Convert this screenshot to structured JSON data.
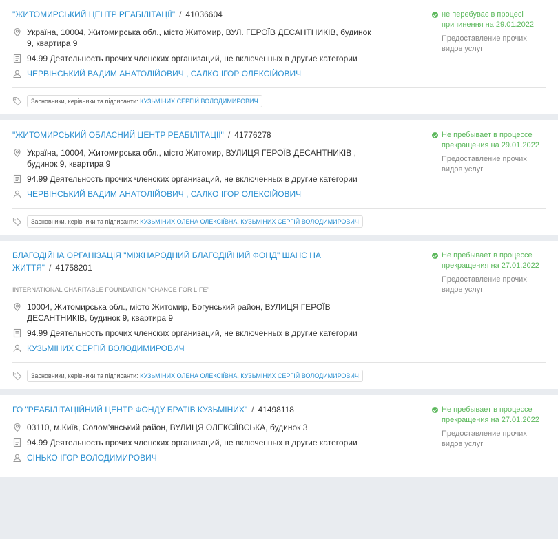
{
  "results": [
    {
      "title": "\"ЖИТОМИРСЬКИЙ ЦЕНТР РЕАБІЛІТАЦІЇ\"",
      "separator": "/",
      "code": "41036604",
      "address": "Україна, 10004, Житомирська обл., місто Житомир, ВУЛ. ГЕРОЇВ ДЕСАНТНИКІВ, будинок 9, квартира 9",
      "activity": "94.99 Деятельность прочих членских организаций, не включенных в другие категории",
      "people": [
        "ЧЕРВІНСЬКИЙ ВАДИМ АНАТОЛІЙОВИЧ",
        "САЛКО ІГОР ОЛЕКСІЙОВИЧ"
      ],
      "status": "не перебуває в процесі припинення на 29.01.2022",
      "service": "Предоставление прочих видов услуг",
      "tag_label": "Засновники, керівники та підписанти:",
      "tag_names": "КУЗЬМІНИХ СЕРГІЙ ВОЛОДИМИРОВИЧ"
    },
    {
      "title": "\"ЖИТОМИРСЬКИЙ ОБЛАСНИЙ ЦЕНТР РЕАБІЛІТАЦІЇ\"",
      "separator": "/",
      "code": "41776278",
      "address": "Україна, 10004, Житомирська обл., місто Житомир, ВУЛИЦЯ ГЕРОЇВ ДЕСАНТНИКІВ , будинок 9, квартира 9",
      "activity": "94.99 Деятельность прочих членских организаций, не включенных в другие категории",
      "people": [
        "ЧЕРВІНСЬКИЙ ВАДИМ АНАТОЛІЙОВИЧ",
        "САЛКО ІГОР ОЛЕКСІЙОВИЧ"
      ],
      "status": "Не пребывает в процессе прекращения на 29.01.2022",
      "service": "Предоставление прочих видов услуг",
      "tag_label": "Засновники, керівники та підписанти:",
      "tag_names": "КУЗЬМІНИХ ОЛЕНА ОЛЕКСІЇВНА, КУЗЬМІНИХ СЕРГІЙ ВОЛОДИМИРОВИЧ"
    },
    {
      "title": "БЛАГОДІЙНА ОРГАНІЗАЦІЯ \"МІЖНАРОДНИЙ БЛАГОДІЙНИЙ ФОНД\" ШАНС НА ЖИТТЯ\"",
      "separator": "/",
      "code": "41758201",
      "en_name": "INTERNATIONAL CHARITABLE FOUNDATION \"CHANCE FOR LIFE\"",
      "address": "10004, Житомирська обл., місто Житомир, Богунський район, ВУЛИЦЯ ГЕРОЇВ ДЕСАНТНИКІВ, будинок 9, квартира 9",
      "activity": "94.99 Деятельность прочих членских организаций, не включенных в другие категории",
      "people": [
        "КУЗЬМІНИХ СЕРГІЙ ВОЛОДИМИРОВИЧ"
      ],
      "status": "Не пребывает в процессе прекращения на 27.01.2022",
      "service": "Предоставление прочих видов услуг",
      "tag_label": "Засновники, керівники та підписанти:",
      "tag_names": "КУЗЬМІНИХ ОЛЕНА ОЛЕКСІЇВНА, КУЗЬМІНИХ СЕРГІЙ ВОЛОДИМИРОВИЧ"
    },
    {
      "title": "ГО \"РЕАБІЛІТАЦІЙНИЙ ЦЕНТР ФОНДУ БРАТІВ КУЗЬМІНИХ\"",
      "separator": "/",
      "code": "41498118",
      "address": "03110, м.Київ, Солом'янський район, ВУЛИЦЯ ОЛЕКСІЇВСЬКА, будинок 3",
      "activity": "94.99 Деятельность прочих членских организаций, не включенных в другие категории",
      "people": [
        "СІНЬКО ІГОР ВОЛОДИМИРОВИЧ"
      ],
      "status": "Не пребывает в процессе прекращения на 27.01.2022",
      "service": "Предоставление прочих видов услуг"
    }
  ],
  "people_separator": " , ",
  "icons": {
    "address": "location-pin-icon",
    "activity": "document-icon",
    "people": "person-icon",
    "tag": "tag-icon",
    "status": "check-circle-icon"
  },
  "colors": {
    "link": "#2a8fd0",
    "status": "#5cb85c"
  }
}
